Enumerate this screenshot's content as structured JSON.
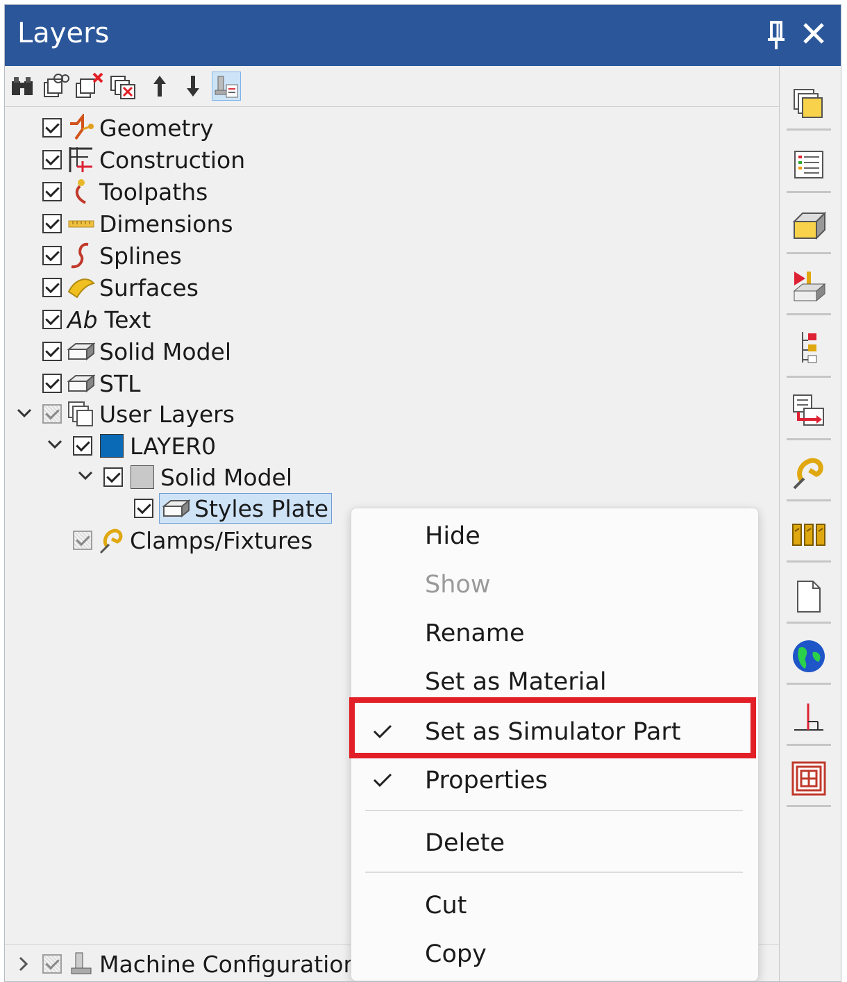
{
  "panel": {
    "title": "Layers"
  },
  "tree": {
    "items": [
      {
        "label": "Geometry"
      },
      {
        "label": "Construction"
      },
      {
        "label": "Toolpaths"
      },
      {
        "label": "Dimensions"
      },
      {
        "label": "Splines"
      },
      {
        "label": "Surfaces"
      },
      {
        "label": "Text",
        "icon_text": "Ab"
      },
      {
        "label": "Solid Model"
      },
      {
        "label": "STL"
      },
      {
        "label": "User Layers"
      },
      {
        "label": "LAYER0",
        "color": "#0a6ab6"
      },
      {
        "label": "Solid Model",
        "color": "#c8c8c8"
      },
      {
        "label": "Styles Plate"
      },
      {
        "label": "Clamps/Fixtures"
      }
    ],
    "bottom": {
      "label": "Machine Configuration"
    }
  },
  "context_menu": {
    "items": [
      {
        "label": "Hide",
        "enabled": true,
        "checked": false
      },
      {
        "label": "Show",
        "enabled": false,
        "checked": false
      },
      {
        "label": "Rename",
        "enabled": true,
        "checked": false
      },
      {
        "label": "Set as Material",
        "enabled": true,
        "checked": false
      },
      {
        "label": "Set as Simulator Part",
        "enabled": true,
        "checked": true,
        "highlighted": true
      },
      {
        "label": "Properties",
        "enabled": true,
        "checked": true
      },
      {
        "label": "Delete",
        "enabled": true,
        "checked": false
      },
      {
        "label": "Cut",
        "enabled": true,
        "checked": false
      },
      {
        "label": "Copy",
        "enabled": true,
        "checked": false
      }
    ]
  },
  "colors": {
    "titlebar": "#2b579a",
    "highlight": "#e21f26",
    "selection": "#cfe3f7"
  }
}
